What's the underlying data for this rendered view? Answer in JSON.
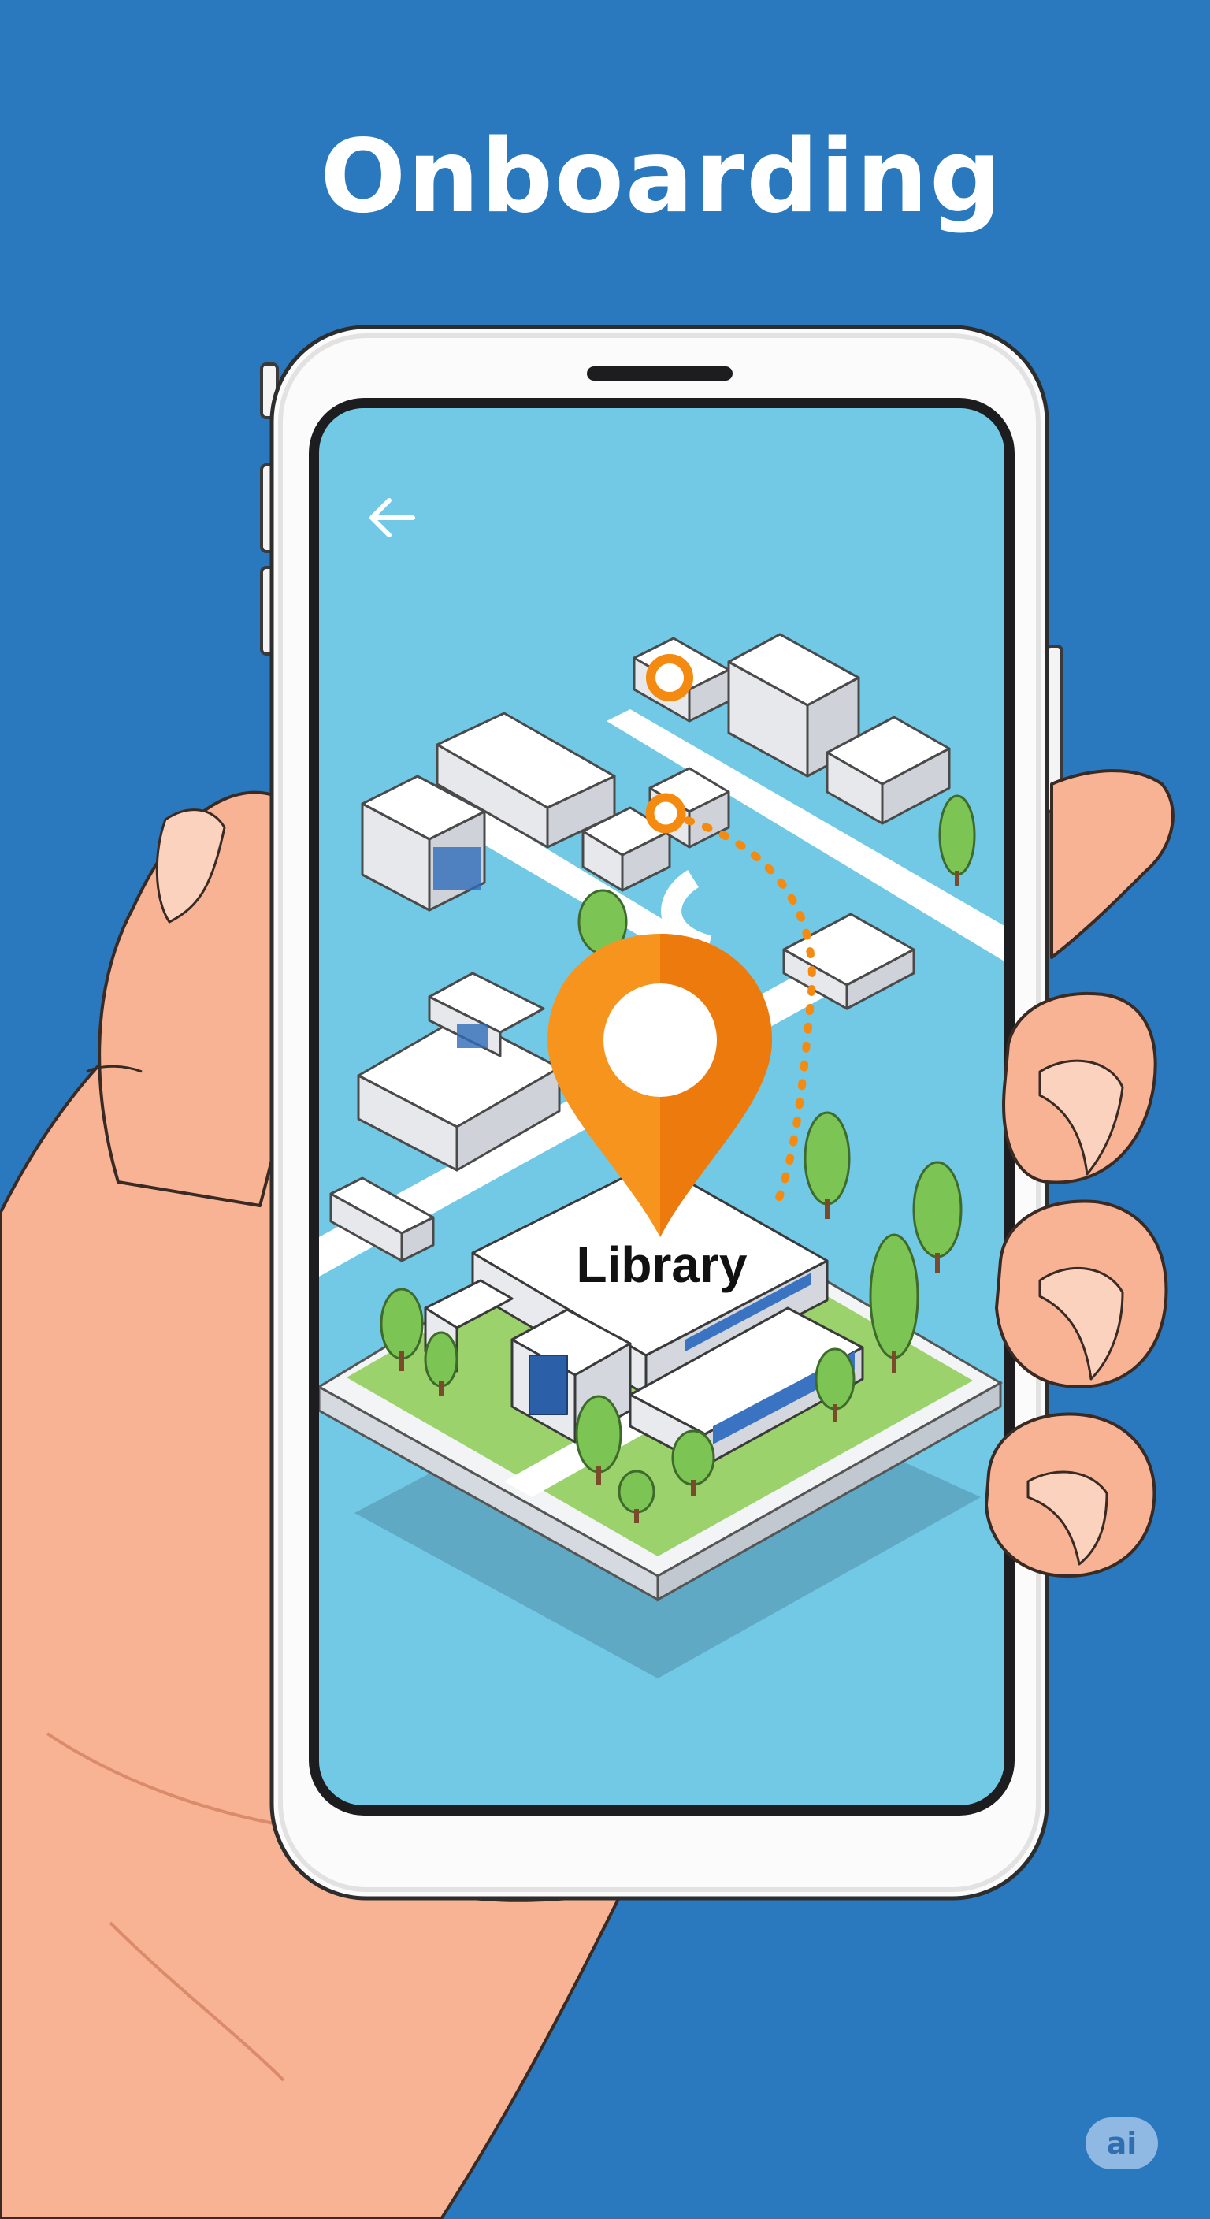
{
  "header": {
    "title": "Onboarding"
  },
  "screen": {
    "back_icon": "arrow-left-icon",
    "destination": {
      "label": "Library",
      "pin_icon": "map-pin-icon",
      "pin_color": "#f48a0f"
    },
    "origin_icon": "location-ring-icon",
    "waypoint_icon": "location-ring-icon"
  },
  "badge": {
    "label": "ai"
  },
  "colors": {
    "background": "#2a78bd",
    "screen": "#72c9e6",
    "accent": "#f48a0f",
    "grass": "#9bd26b",
    "skin": "#f7b393"
  }
}
